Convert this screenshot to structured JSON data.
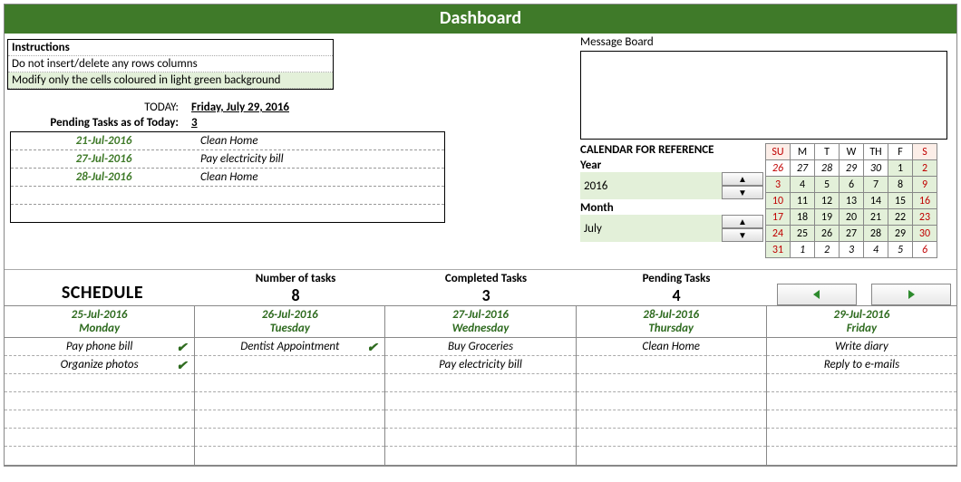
{
  "title": "Dashboard",
  "instructions": {
    "heading": "Instructions",
    "lines": [
      "Do not insert/delete any rows columns",
      "Modify only the cells coloured in light green background"
    ]
  },
  "today": {
    "label": "TODAY:",
    "value": "Friday, July 29, 2016"
  },
  "pending_summary": {
    "label": "Pending Tasks as of Today:",
    "count": "3"
  },
  "pending_list": [
    {
      "date": "21-Jul-2016",
      "task": "Clean Home"
    },
    {
      "date": "27-Jul-2016",
      "task": "Pay electricity bill"
    },
    {
      "date": "28-Jul-2016",
      "task": "Clean Home"
    }
  ],
  "message_board_label": "Message Board",
  "reference": {
    "heading": "CALENDAR FOR REFERENCE",
    "year_label": "Year",
    "year_value": "2016",
    "month_label": "Month",
    "month_value": "July"
  },
  "calendar": {
    "dow": [
      "SU",
      "M",
      "T",
      "W",
      "TH",
      "F",
      "S"
    ],
    "rows": [
      [
        {
          "n": "26",
          "in": false
        },
        {
          "n": "27",
          "in": false
        },
        {
          "n": "28",
          "in": false
        },
        {
          "n": "29",
          "in": false
        },
        {
          "n": "30",
          "in": false
        },
        {
          "n": "1",
          "in": true
        },
        {
          "n": "2",
          "in": true
        }
      ],
      [
        {
          "n": "3",
          "in": true
        },
        {
          "n": "4",
          "in": true
        },
        {
          "n": "5",
          "in": true
        },
        {
          "n": "6",
          "in": true
        },
        {
          "n": "7",
          "in": true
        },
        {
          "n": "8",
          "in": true
        },
        {
          "n": "9",
          "in": true
        }
      ],
      [
        {
          "n": "10",
          "in": true
        },
        {
          "n": "11",
          "in": true
        },
        {
          "n": "12",
          "in": true
        },
        {
          "n": "13",
          "in": true
        },
        {
          "n": "14",
          "in": true
        },
        {
          "n": "15",
          "in": true
        },
        {
          "n": "16",
          "in": true
        }
      ],
      [
        {
          "n": "17",
          "in": true
        },
        {
          "n": "18",
          "in": true
        },
        {
          "n": "19",
          "in": true
        },
        {
          "n": "20",
          "in": true
        },
        {
          "n": "21",
          "in": true
        },
        {
          "n": "22",
          "in": true
        },
        {
          "n": "23",
          "in": true
        }
      ],
      [
        {
          "n": "24",
          "in": true
        },
        {
          "n": "25",
          "in": true
        },
        {
          "n": "26",
          "in": true
        },
        {
          "n": "27",
          "in": true
        },
        {
          "n": "28",
          "in": true
        },
        {
          "n": "29",
          "in": true
        },
        {
          "n": "30",
          "in": true
        }
      ],
      [
        {
          "n": "31",
          "in": true
        },
        {
          "n": "1",
          "in": false
        },
        {
          "n": "2",
          "in": false
        },
        {
          "n": "3",
          "in": false
        },
        {
          "n": "4",
          "in": false
        },
        {
          "n": "5",
          "in": false
        },
        {
          "n": "6",
          "in": false
        }
      ]
    ]
  },
  "schedule": {
    "title": "SCHEDULE",
    "stats": {
      "num_label": "Number of tasks",
      "num_value": "8",
      "completed_label": "Completed Tasks",
      "completed_value": "3",
      "pending_label": "Pending Tasks",
      "pending_value": "4"
    },
    "days": [
      {
        "date": "25-Jul-2016",
        "name": "Monday",
        "tasks": [
          {
            "t": "Pay phone bill",
            "done": true
          },
          {
            "t": "Organize photos",
            "done": true
          },
          {
            "t": "",
            "done": false
          },
          {
            "t": "",
            "done": false
          },
          {
            "t": "",
            "done": false
          },
          {
            "t": "",
            "done": false
          },
          {
            "t": "",
            "done": false
          }
        ]
      },
      {
        "date": "26-Jul-2016",
        "name": "Tuesday",
        "tasks": [
          {
            "t": "Dentist Appointment",
            "done": true
          },
          {
            "t": "",
            "done": false
          },
          {
            "t": "",
            "done": false
          },
          {
            "t": "",
            "done": false
          },
          {
            "t": "",
            "done": false
          },
          {
            "t": "",
            "done": false
          },
          {
            "t": "",
            "done": false
          }
        ]
      },
      {
        "date": "27-Jul-2016",
        "name": "Wednesday",
        "tasks": [
          {
            "t": "Buy Groceries",
            "done": false
          },
          {
            "t": "Pay electricity bill",
            "done": false
          },
          {
            "t": "",
            "done": false
          },
          {
            "t": "",
            "done": false
          },
          {
            "t": "",
            "done": false
          },
          {
            "t": "",
            "done": false
          },
          {
            "t": "",
            "done": false
          }
        ]
      },
      {
        "date": "28-Jul-2016",
        "name": "Thursday",
        "tasks": [
          {
            "t": "Clean Home",
            "done": false
          },
          {
            "t": "",
            "done": false
          },
          {
            "t": "",
            "done": false
          },
          {
            "t": "",
            "done": false
          },
          {
            "t": "",
            "done": false
          },
          {
            "t": "",
            "done": false
          },
          {
            "t": "",
            "done": false
          }
        ]
      },
      {
        "date": "29-Jul-2016",
        "name": "Friday",
        "tasks": [
          {
            "t": "Write diary",
            "done": false
          },
          {
            "t": "Reply to e-mails",
            "done": false
          },
          {
            "t": "",
            "done": false
          },
          {
            "t": "",
            "done": false
          },
          {
            "t": "",
            "done": false
          },
          {
            "t": "",
            "done": false
          },
          {
            "t": "",
            "done": false
          }
        ]
      }
    ]
  }
}
